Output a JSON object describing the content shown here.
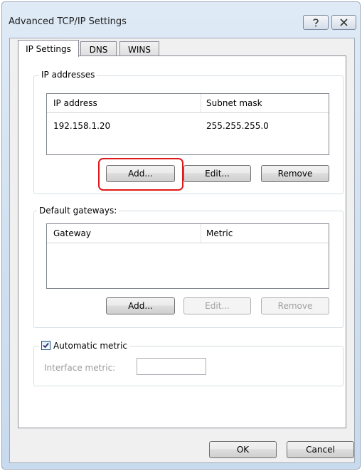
{
  "window": {
    "title": "Advanced TCP/IP Settings",
    "help_icon": "help-icon",
    "close_icon": "close-icon"
  },
  "tabs": [
    {
      "label": "IP Settings",
      "active": true
    },
    {
      "label": "DNS",
      "active": false
    },
    {
      "label": "WINS",
      "active": false
    }
  ],
  "ip_addresses": {
    "group_label": "IP addresses",
    "columns": [
      "IP address",
      "Subnet mask"
    ],
    "rows": [
      {
        "ip": "192.158.1.20",
        "mask": "255.255.255.0"
      }
    ],
    "buttons": {
      "add": "Add...",
      "edit": "Edit...",
      "remove": "Remove"
    }
  },
  "gateways": {
    "group_label": "Default gateways:",
    "columns": [
      "Gateway",
      "Metric"
    ],
    "buttons": {
      "add": "Add...",
      "edit": "Edit...",
      "remove": "Remove"
    }
  },
  "metric": {
    "checkbox_label": "Automatic metric",
    "checked": true,
    "interface_label": "Interface metric:",
    "interface_value": ""
  },
  "footer": {
    "ok": "OK",
    "cancel": "Cancel"
  },
  "colors": {
    "highlight": "#e01a1a"
  }
}
